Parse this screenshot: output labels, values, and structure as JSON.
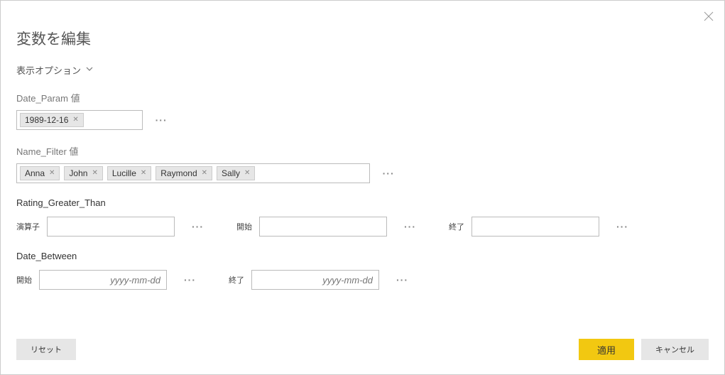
{
  "dialog": {
    "title": "変数を編集",
    "display_options": "表示オプション"
  },
  "fields": {
    "date_param": {
      "label": "Date_Param 値",
      "chips": [
        "1989-12-16"
      ]
    },
    "name_filter": {
      "label": "Name_Filter 値",
      "chips": [
        "Anna",
        "John",
        "Lucille",
        "Raymond",
        "Sally"
      ]
    },
    "rating": {
      "label": "Rating_Greater_Than",
      "operator_label": "演算子",
      "start_label": "開始",
      "end_label": "終了"
    },
    "date_between": {
      "label": "Date_Between",
      "start_label": "開始",
      "end_label": "終了",
      "placeholder": "yyyy-mm-dd"
    }
  },
  "buttons": {
    "reset": "リセット",
    "apply": "適用",
    "cancel": "キャンセル"
  }
}
